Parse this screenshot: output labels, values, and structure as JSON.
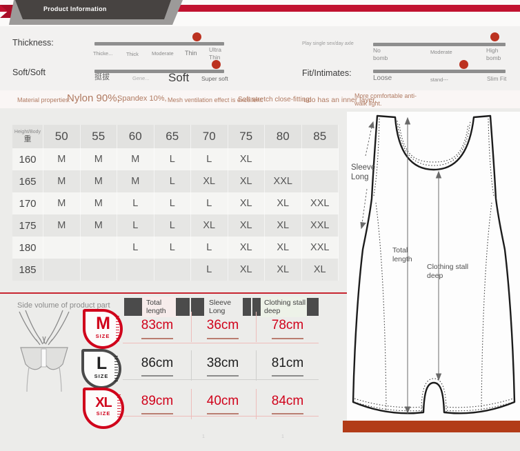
{
  "banner": {
    "title": "Product Information"
  },
  "sliders": {
    "thickness": {
      "label": "Thickness:",
      "ticks": [
        "Thicke...",
        "Thick",
        "Moderate",
        "Thin",
        "Ultra Thin"
      ]
    },
    "soft": {
      "label": "Soft/Soft",
      "ticks": [
        "挺拔",
        "Gene...",
        "Soft",
        "Super soft"
      ]
    },
    "elastic": {
      "label": "Play single sex/day axle",
      "ticks": [
        "No bomb",
        "Moderate",
        "High bomb"
      ]
    },
    "fit": {
      "label": "Fit/Intimates:",
      "ticks": [
        "Loose",
        "stand---",
        "Slim Fit"
      ]
    }
  },
  "materials": {
    "label": "Material properties:",
    "items": [
      "Nylon 90%,",
      "Spandex 10%,",
      "Mesh ventilation effect is excellent:",
      "Soft stretch close-fitting:",
      "udo has an inner layer,",
      "More comfortable anti-walk light."
    ]
  },
  "size_table": {
    "corner_top": "Height/Body",
    "corner_bottom": "重",
    "columns": [
      "50",
      "55",
      "60",
      "65",
      "70",
      "75",
      "80",
      "85"
    ],
    "rows": [
      {
        "height": "160",
        "cells": [
          "M",
          "M",
          "M",
          "L",
          "L",
          "XL",
          "",
          ""
        ]
      },
      {
        "height": "165",
        "cells": [
          "M",
          "M",
          "M",
          "L",
          "XL",
          "XL",
          "XXL",
          ""
        ]
      },
      {
        "height": "170",
        "cells": [
          "M",
          "M",
          "L",
          "L",
          "L",
          "XL",
          "XL",
          "XXL"
        ]
      },
      {
        "height": "175",
        "cells": [
          "M",
          "M",
          "L",
          "L",
          "XL",
          "XL",
          "XL",
          "XXL"
        ]
      },
      {
        "height": "180",
        "cells": [
          "",
          "",
          "L",
          "L",
          "L",
          "XL",
          "XL",
          "XXL"
        ]
      },
      {
        "height": "185",
        "cells": [
          "",
          "",
          "",
          "",
          "L",
          "XL",
          "XL",
          "XL"
        ]
      }
    ]
  },
  "side_volume": {
    "title": "Side volume of product part",
    "legend": [
      {
        "label": "Total length"
      },
      {
        "label": "Sleeve Long"
      },
      {
        "label": "Clothing stall deep"
      }
    ],
    "rows": [
      {
        "size": "M",
        "sub": "SIZE",
        "values": [
          "83cm",
          "36cm",
          "78cm"
        ]
      },
      {
        "size": "L",
        "sub": "SIZE",
        "values": [
          "86cm",
          "38cm",
          "81cm"
        ]
      },
      {
        "size": "XL",
        "sub": "SIZE",
        "values": [
          "89cm",
          "40cm",
          "84cm"
        ]
      }
    ]
  },
  "diagram": {
    "sleeve_label": "Sleeve Long",
    "total_label": "Total length",
    "stall_label": "Clothing stall deep"
  },
  "footer": {
    "marks": [
      "1",
      "1"
    ]
  },
  "colors": {
    "ribbon_red": "#c1122f",
    "slider_dot_red": "#bc3220",
    "measure_red": "#d0021b",
    "footer_bar_orange": "#b23c18",
    "banner_dark": "#474341"
  }
}
